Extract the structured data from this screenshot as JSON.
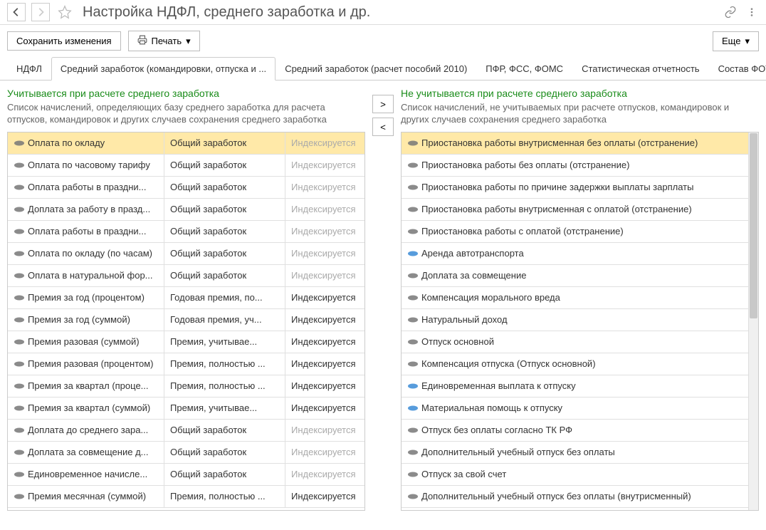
{
  "header": {
    "title": "Настройка НДФЛ, среднего заработка и др."
  },
  "subbar": {
    "save_label": "Сохранить изменения",
    "print_label": "Печать",
    "more_label": "Еще"
  },
  "tabs": [
    {
      "label": "НДФЛ"
    },
    {
      "label": "Средний заработок (командировки, отпуска и ..."
    },
    {
      "label": "Средний заработок (расчет пособий 2010)"
    },
    {
      "label": "ПФР, ФСС, ФОМС"
    },
    {
      "label": "Статистическая отчетность"
    },
    {
      "label": "Состав ФОТ"
    }
  ],
  "left": {
    "header": "Учитывается при расчете среднего заработка",
    "desc": "Список начислений, определяющих базу среднего заработка для расчета отпусков, командировок и других случаев сохранения среднего заработка",
    "rows": [
      {
        "name": "Оплата по окладу",
        "type": "Общий заработок",
        "index": "Индексируется",
        "indexed_gray": true,
        "selected": true,
        "icon": "gray"
      },
      {
        "name": "Оплата по часовому тарифу",
        "type": "Общий заработок",
        "index": "Индексируется",
        "indexed_gray": true,
        "icon": "gray"
      },
      {
        "name": "Оплата работы в праздни...",
        "type": "Общий заработок",
        "index": "Индексируется",
        "indexed_gray": true,
        "icon": "gray"
      },
      {
        "name": "Доплата за работу в празд...",
        "type": "Общий заработок",
        "index": "Индексируется",
        "indexed_gray": true,
        "icon": "gray"
      },
      {
        "name": "Оплата работы в праздни...",
        "type": "Общий заработок",
        "index": "Индексируется",
        "indexed_gray": true,
        "icon": "gray"
      },
      {
        "name": "Оплата по окладу (по часам)",
        "type": "Общий заработок",
        "index": "Индексируется",
        "indexed_gray": true,
        "icon": "gray"
      },
      {
        "name": "Оплата в натуральной фор...",
        "type": "Общий заработок",
        "index": "Индексируется",
        "indexed_gray": true,
        "icon": "gray"
      },
      {
        "name": "Премия за год (процентом)",
        "type": "Годовая премия, по...",
        "index": "Индексируется",
        "indexed_gray": false,
        "icon": "gray"
      },
      {
        "name": "Премия за год (суммой)",
        "type": "Годовая премия, уч...",
        "index": "Индексируется",
        "indexed_gray": false,
        "icon": "gray"
      },
      {
        "name": "Премия разовая (суммой)",
        "type": "Премия, учитывае...",
        "index": "Индексируется",
        "indexed_gray": false,
        "icon": "gray"
      },
      {
        "name": "Премия разовая (процентом)",
        "type": "Премия, полностью ...",
        "index": "Индексируется",
        "indexed_gray": false,
        "icon": "gray"
      },
      {
        "name": "Премия за квартал (проце...",
        "type": "Премия, полностью ...",
        "index": "Индексируется",
        "indexed_gray": false,
        "icon": "gray"
      },
      {
        "name": "Премия за квартал (суммой)",
        "type": "Премия, учитывае...",
        "index": "Индексируется",
        "indexed_gray": false,
        "icon": "gray"
      },
      {
        "name": "Доплата до среднего зара...",
        "type": "Общий заработок",
        "index": "Индексируется",
        "indexed_gray": true,
        "icon": "gray"
      },
      {
        "name": "Доплата за совмещение д...",
        "type": "Общий заработок",
        "index": "Индексируется",
        "indexed_gray": true,
        "icon": "gray"
      },
      {
        "name": "Единовременное начисле...",
        "type": "Общий заработок",
        "index": "Индексируется",
        "indexed_gray": true,
        "icon": "gray"
      },
      {
        "name": "Премия месячная (суммой)",
        "type": "Премия, полностью ...",
        "index": "Индексируется",
        "indexed_gray": false,
        "icon": "gray"
      }
    ]
  },
  "right": {
    "header": "Не учитывается при расчете среднего заработка",
    "desc": "Список начислений, не учитываемых при расчете отпусков, командировок и других случаев сохранения среднего заработка",
    "rows": [
      {
        "name": "Приостановка работы внутрисменная без оплаты (отстранение)",
        "selected": true,
        "icon": "gray"
      },
      {
        "name": "Приостановка работы без оплаты (отстранение)",
        "icon": "gray"
      },
      {
        "name": "Приостановка работы по причине задержки выплаты зарплаты",
        "icon": "gray"
      },
      {
        "name": "Приостановка работы внутрисменная с оплатой (отстранение)",
        "icon": "gray"
      },
      {
        "name": "Приостановка работы с оплатой (отстранение)",
        "icon": "gray"
      },
      {
        "name": "Аренда автотранспорта",
        "icon": "blue"
      },
      {
        "name": "Доплата за совмещение",
        "icon": "gray"
      },
      {
        "name": "Компенсация морального вреда",
        "icon": "gray"
      },
      {
        "name": "Натуральный доход",
        "icon": "gray"
      },
      {
        "name": "Отпуск основной",
        "icon": "gray"
      },
      {
        "name": "Компенсация отпуска (Отпуск основной)",
        "icon": "gray"
      },
      {
        "name": "Единовременная выплата к отпуску",
        "icon": "blue"
      },
      {
        "name": "Материальная помощь к отпуску",
        "icon": "blue"
      },
      {
        "name": "Отпуск без оплаты согласно ТК РФ",
        "icon": "gray"
      },
      {
        "name": "Дополнительный учебный отпуск без оплаты",
        "icon": "gray"
      },
      {
        "name": "Отпуск за свой счет",
        "icon": "gray"
      },
      {
        "name": "Дополнительный учебный отпуск без оплаты (внутрисменный)",
        "icon": "gray"
      }
    ]
  }
}
